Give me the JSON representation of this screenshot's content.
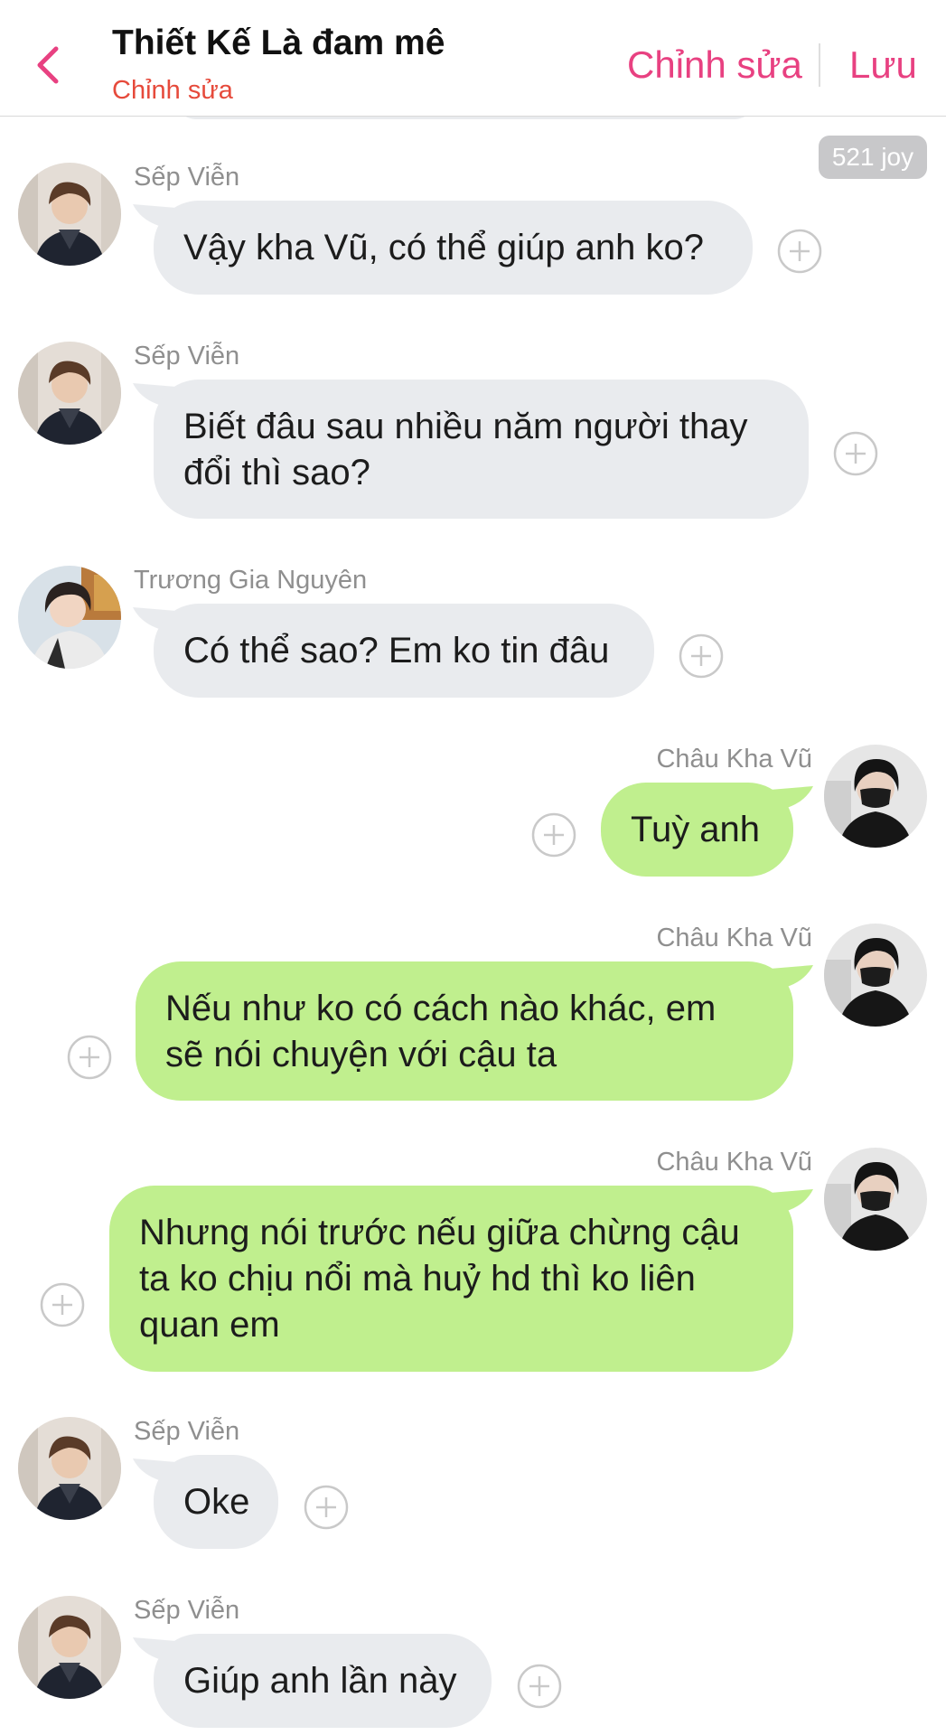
{
  "header": {
    "title": "Thiết Kế Là đam mê",
    "subtitle": "Chỉnh sửa",
    "edit_label": "Chỉnh sửa",
    "save_label": "Lưu",
    "back_icon": "chevron-left-icon"
  },
  "joy_badge": "521 joy",
  "colors": {
    "accent": "#e84181",
    "subtitle": "#e64a3b",
    "bubble_in": "#e9ebee",
    "bubble_out": "#c0ef8e"
  },
  "messages": [
    {
      "sender": "Sếp Viễn",
      "text": "Vậy kha Vũ, có thể giúp anh ko?",
      "side": "left"
    },
    {
      "sender": "Sếp Viễn",
      "text": "Biết đâu sau nhiều năm người thay\nđổi thì sao?",
      "side": "left"
    },
    {
      "sender": "Trương Gia Nguyên",
      "text": "Có thể sao? Em ko tin đâu",
      "side": "left"
    },
    {
      "sender": "Châu Kha Vũ",
      "text": "Tuỳ anh",
      "side": "right"
    },
    {
      "sender": "Châu Kha Vũ",
      "text": "Nếu  như ko có cách nào khác, em\nsẽ nói chuyện với cậu ta",
      "side": "right"
    },
    {
      "sender": "Châu Kha Vũ",
      "text": "Nhưng nói trước nếu giữa chừng cậu\nta ko chịu nổi mà huỷ hd thì ko liên\nquan em",
      "side": "right"
    },
    {
      "sender": "Sếp Viễn",
      "text": "Oke",
      "side": "left"
    },
    {
      "sender": "Sếp Viễn",
      "text": "Giúp anh lần này",
      "side": "left"
    }
  ]
}
